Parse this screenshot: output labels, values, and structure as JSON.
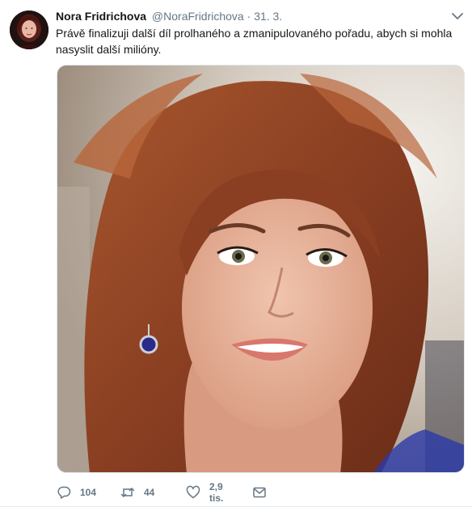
{
  "tweet": {
    "author_name": "Nora Fridrichova",
    "author_handle": "@NoraFridrichova",
    "separator": "·",
    "date": "31. 3.",
    "text": "Právě finalizuji další díl prolhaného a zmanipulovaného pořadu, abych si mohla nasyslit další milióny.",
    "media": {
      "type": "photo",
      "description_icon": "photo"
    },
    "actions": {
      "reply": {
        "icon": "reply-icon",
        "count": "104"
      },
      "retweet": {
        "icon": "retweet-icon",
        "count": "44"
      },
      "like": {
        "icon": "heart-icon",
        "count": "2,9 tis."
      },
      "message": {
        "icon": "envelope-icon"
      }
    }
  },
  "colors": {
    "primary_text": "#14171a",
    "secondary_text": "#657786",
    "border": "#e6ecf0"
  }
}
